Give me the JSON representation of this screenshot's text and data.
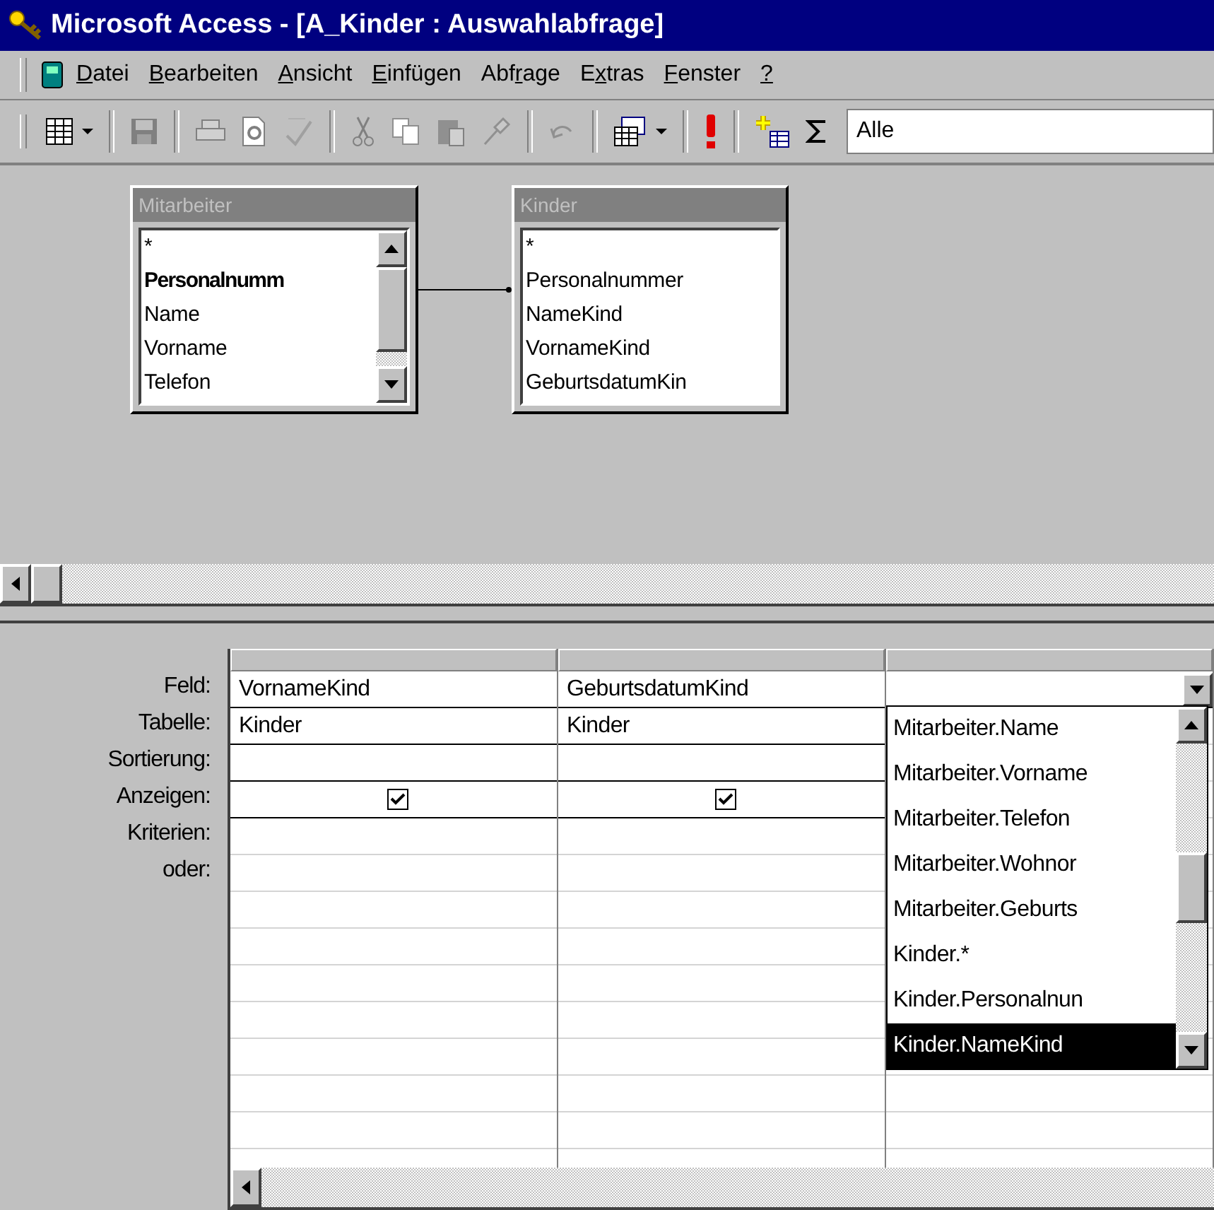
{
  "window": {
    "title": "Microsoft Access - [A_Kinder : Auswahlabfrage]"
  },
  "menu": [
    {
      "key": "D",
      "after": "atei"
    },
    {
      "key": "B",
      "after": "earbeiten"
    },
    {
      "key": "A",
      "after": "nsicht"
    },
    {
      "key": "E",
      "after": "infügen"
    },
    {
      "before": "Abf",
      "key": "r",
      "after": "age"
    },
    {
      "before": "E",
      "key": "x",
      "after": "tras"
    },
    {
      "key": "F",
      "after": "enster"
    },
    {
      "key": "?"
    }
  ],
  "toolbar": {
    "combo_value": "Alle"
  },
  "tables": [
    {
      "title": "Mitarbeiter",
      "scrollbar": true,
      "fields": [
        {
          "name": "*",
          "key": false
        },
        {
          "name": "Personalnumm",
          "key": true
        },
        {
          "name": "Name",
          "key": false
        },
        {
          "name": "Vorname",
          "key": false
        },
        {
          "name": "Telefon",
          "key": false
        }
      ]
    },
    {
      "title": "Kinder",
      "scrollbar": false,
      "fields": [
        {
          "name": "*",
          "key": false
        },
        {
          "name": "Personalnummer",
          "key": false
        },
        {
          "name": "NameKind",
          "key": false
        },
        {
          "name": "VornameKind",
          "key": false
        },
        {
          "name": "GeburtsdatumKin",
          "key": false
        }
      ]
    }
  ],
  "grid": {
    "row_labels": [
      "Feld:",
      "Tabelle:",
      "Sortierung:",
      "Anzeigen:",
      "Kriterien:",
      "oder:"
    ],
    "columns": [
      {
        "feld": "VornameKind",
        "tabelle": "Kinder",
        "show": true,
        "dropdown": false
      },
      {
        "feld": "GeburtsdatumKind",
        "tabelle": "Kinder",
        "show": true,
        "dropdown": false
      },
      {
        "dropdown": true
      }
    ]
  },
  "dropdown_list": [
    {
      "text": "Mitarbeiter.Name",
      "selected": false
    },
    {
      "text": "Mitarbeiter.Vorname",
      "selected": false
    },
    {
      "text": "Mitarbeiter.Telefon",
      "selected": false
    },
    {
      "text": "Mitarbeiter.Wohnor",
      "selected": false
    },
    {
      "text": "Mitarbeiter.Geburts",
      "selected": false
    },
    {
      "text": "Kinder.*",
      "selected": false
    },
    {
      "text": "Kinder.Personalnun",
      "selected": false
    },
    {
      "text": "Kinder.NameKind",
      "selected": true
    }
  ]
}
